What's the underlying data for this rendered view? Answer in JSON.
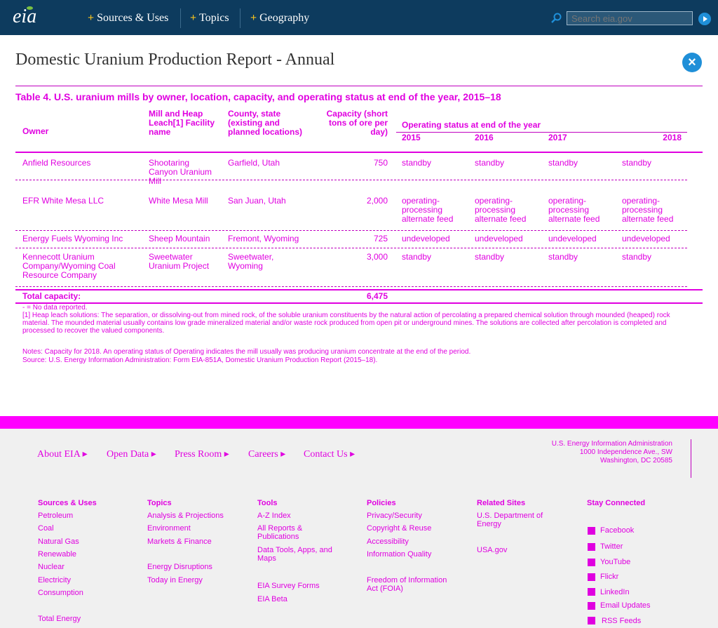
{
  "header": {
    "logo": "eia",
    "nav": [
      {
        "label": "Sources & Uses"
      },
      {
        "label": "Topics"
      },
      {
        "label": "Geography"
      }
    ],
    "search_placeholder": "Search eia.gov"
  },
  "page": {
    "title": "Domestic Uranium Production Report - Annual",
    "close": "×"
  },
  "table": {
    "title": "Table 4. U.S. uranium mills by owner, location, capacity, and operating status at end of the year, 2015–18",
    "headers": {
      "owner": "Owner",
      "facility": "Mill and Heap Leach[1] Facility name",
      "county": "County, state (existing and planned locations)",
      "capacity": "Capacity (short tons of ore per day)",
      "status_group": "Operating status at end of the year",
      "years": [
        "2015",
        "2016",
        "2017",
        "2018"
      ]
    },
    "rows": [
      {
        "owner": "Anfield Resources",
        "facility": "Shootaring Canyon Uranium Mill",
        "county": "Garfield, Utah",
        "capacity": "750",
        "status": [
          "standby",
          "standby",
          "standby",
          "standby"
        ]
      },
      {
        "owner": "EFR White Mesa LLC",
        "facility": "White Mesa Mill",
        "county": "San Juan, Utah",
        "capacity": "2,000",
        "status": [
          "operating-processing alternate feed",
          "operating-processing alternate feed",
          "operating-processing alternate feed",
          "operating-processing alternate feed"
        ]
      },
      {
        "owner": "Energy Fuels Wyoming Inc",
        "facility": "Sheep Mountain",
        "county": "Fremont, Wyoming",
        "capacity": "725",
        "status": [
          "undeveloped",
          "undeveloped",
          "undeveloped",
          "undeveloped"
        ]
      },
      {
        "owner": "Kennecott Uranium Company/Wyoming Coal Resource Company",
        "facility": "Sweetwater Uranium Project",
        "county": "Sweetwater, Wyoming",
        "capacity": "3,000",
        "status": [
          "standby",
          "standby",
          "standby",
          "standby"
        ]
      }
    ],
    "total_label": "Total capacity:",
    "total_value": "6,475",
    "notes": [
      "- = No data reported.",
      "[1] Heap leach solutions: The separation, or dissolving-out from mined rock, of the soluble uranium constituents by the natural action of percolating a prepared chemical solution through mounded (heaped) rock material. The mounded material usually contains low grade mineralized material and/or waste rock produced from open pit or underground mines. The solutions are collected after percolation is completed and processed to recover the valued components.",
      "Notes: Capacity for 2018. An operating status of Operating indicates the mill usually was producing uranium concentrate at the end of the period.",
      "Source: U.S. Energy Information Administration: Form EIA-851A, Domestic Uranium Production Report (2015–18)."
    ]
  },
  "footer": {
    "top_links": [
      "About EIA",
      "Open Data",
      "Press Room",
      "Careers",
      "Contact Us"
    ],
    "address": [
      "U.S. Energy Information Administration",
      "1000 Independence Ave., SW",
      "Washington, DC 20585"
    ],
    "columns": [
      {
        "heading": "Sources & Uses",
        "items": [
          "Petroleum",
          "Coal",
          "Natural Gas",
          "Renewable",
          "Nuclear",
          "Electricity",
          "Consumption",
          "Total Energy"
        ]
      },
      {
        "heading": "Topics",
        "items": [
          "Analysis & Projections",
          "Environment",
          "Markets & Finance",
          "Energy Disruptions",
          "Today in Energy"
        ]
      },
      {
        "heading": "Tools",
        "items": [
          "A-Z Index",
          "All Reports & Publications",
          "Data Tools, Apps, and Maps",
          "EIA Survey Forms",
          "EIA Beta"
        ]
      },
      {
        "heading": "Policies",
        "items": [
          "Privacy/Security",
          "Copyright & Reuse",
          "Accessibility",
          "Information Quality",
          "Freedom of Information Act (FOIA)"
        ]
      },
      {
        "heading": "Related Sites",
        "items": [
          "U.S. Department of Energy",
          "USA.gov"
        ]
      },
      {
        "heading": "Stay Connected",
        "items": [
          "Facebook",
          "Twitter",
          "YouTube",
          "Flickr",
          "LinkedIn",
          "Email Updates",
          "RSS Feeds"
        ]
      }
    ]
  }
}
